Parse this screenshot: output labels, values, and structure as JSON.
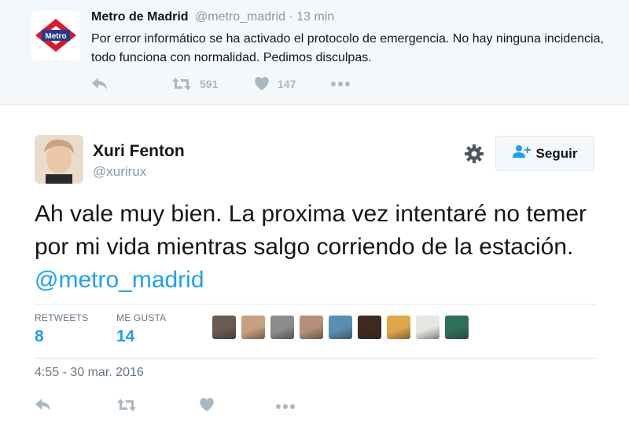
{
  "parent_tweet": {
    "avatar_logo_text": "Metro",
    "name": "Metro de Madrid",
    "handle": "@metro_madrid",
    "separator": " · ",
    "time": "13 min",
    "text": "Por error informático se ha activado el protocolo de emergencia. No hay ninguna incidencia, todo funciona con normalidad. Pedimos disculpas.",
    "retweet_count": "591",
    "like_count": "147",
    "colors": {
      "metro_red": "#d7192b",
      "metro_blue": "#1f3c8f"
    }
  },
  "tweet": {
    "name": "Xuri Fenton",
    "handle": "@xurirux",
    "follow_label": "Seguir",
    "text_before": "Ah vale muy bien. La proxima vez intentaré no temer por mi vida mientras salgo corriendo de la estación. ",
    "mention": "@metro_madrid",
    "retweets_label": "RETWEETS",
    "retweets_value": "8",
    "likes_label": "ME GUSTA",
    "likes_value": "14",
    "date": "4:55 - 30 mar. 2016",
    "liker_avatar_colors": [
      "#6b5a4e",
      "#c9a07e",
      "#8c8c8c",
      "#b58f7a",
      "#5a8fb3",
      "#3f2a1e",
      "#e0a84a",
      "#e8e6e1",
      "#2f6f5a"
    ]
  },
  "icons": {
    "reply": "reply-icon",
    "retweet": "retweet-icon",
    "like": "heart-icon",
    "more": "more-dots-icon",
    "settings": "gear-icon",
    "follow": "add-user-icon"
  },
  "colors": {
    "accent": "#1da1f2",
    "muted": "#8899a6",
    "action_icon": "#aab8c2",
    "parent_bg": "#f5f8fa",
    "border": "#e1e8ed"
  }
}
